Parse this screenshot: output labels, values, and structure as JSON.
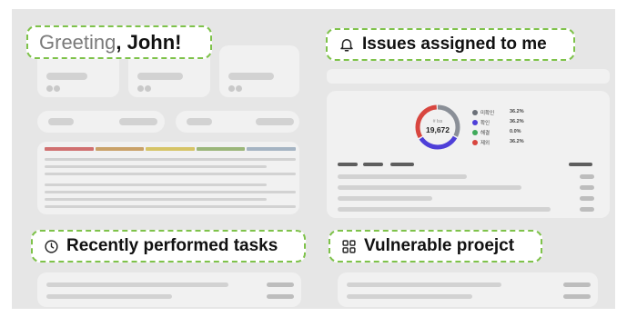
{
  "greeting": {
    "prefix": "Greeting",
    "name": ", John!"
  },
  "sections": {
    "issues": {
      "title": "Issues assigned to me",
      "icon": "bell-icon"
    },
    "recent": {
      "title": "Recently performed tasks",
      "icon": "clock-icon"
    },
    "vulnerable": {
      "title": "Vulnerable proejct",
      "icon": "grid-icon"
    }
  },
  "donut": {
    "caption": "# Iss",
    "total": "19,672",
    "segments": [
      {
        "color": "#8a8f97",
        "value": 36.2
      },
      {
        "color": "#4e3fd8",
        "value": 36.2
      },
      {
        "color": "#3faa5a",
        "value": 0.0
      },
      {
        "color": "#d8463f",
        "value": 36.2
      }
    ]
  },
  "legend": [
    {
      "label": "미확인",
      "value": "36.2%",
      "color": "#6b7078",
      "icon": "circle-dot-icon"
    },
    {
      "label": "확인",
      "value": "36.2%",
      "color": "#4e3fd8",
      "icon": "info-icon"
    },
    {
      "label": "해결",
      "value": "0.0%",
      "color": "#3faa5a",
      "icon": "check-icon"
    },
    {
      "label": "제외",
      "value": "36.2%",
      "color": "#d8463f",
      "icon": "x-icon"
    }
  ],
  "progress_colors": [
    "#d07070",
    "#c9a168",
    "#d6c467",
    "#9bb67a",
    "#a5b4c3"
  ],
  "colors": {
    "accent_border": "#7ec24a"
  }
}
